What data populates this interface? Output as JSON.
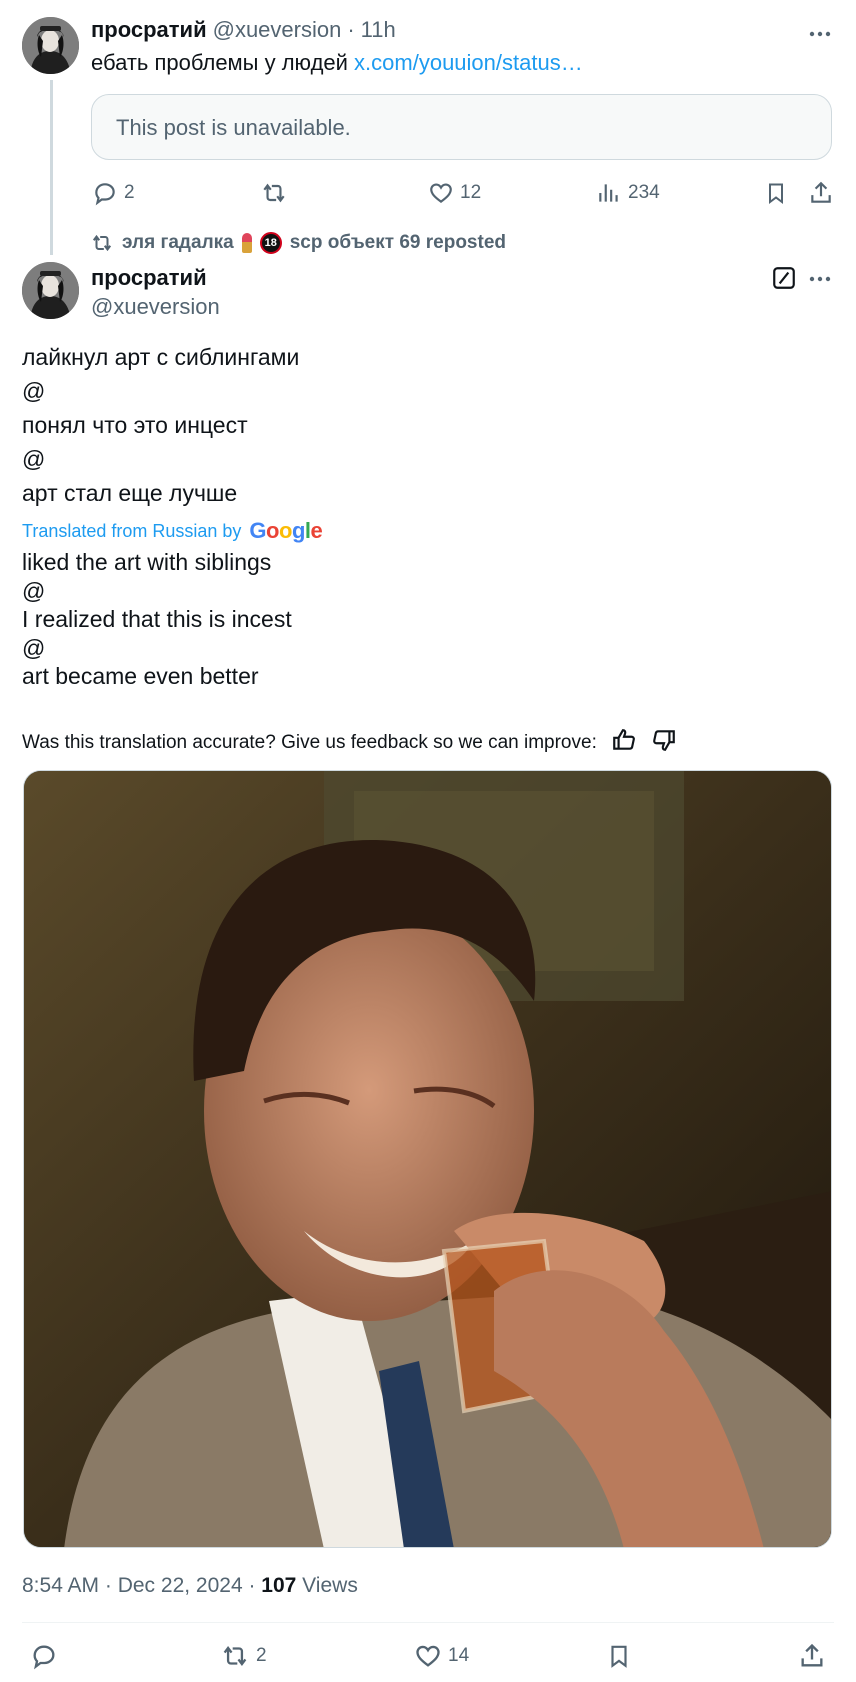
{
  "post1": {
    "author_name": "просратий",
    "author_handle": "@xueversion",
    "separator": "·",
    "time": "11h",
    "text_prefix": "ебать проблемы у людей ",
    "link_text": "x.com/youuion/status…",
    "quote_unavailable": "This post is unavailable.",
    "actions": {
      "replies": "2",
      "reposts": "",
      "likes": "12",
      "views": "234"
    }
  },
  "repost_banner": {
    "user1": "эля гадалка",
    "badge": "18",
    "user2_and_label": "scp объект 69 reposted"
  },
  "post2": {
    "author_name": "просратий",
    "author_handle": "@xueversion",
    "original_lines": [
      "лайкнул арт с сиблингами",
      "@",
      "понял что это инцест",
      "@",
      "арт стал еще лучше"
    ],
    "translated_from": "Translated from Russian by",
    "google_letters": [
      "G",
      "o",
      "o",
      "g",
      "l",
      "e"
    ],
    "translated_lines": [
      "liked the art with siblings",
      "@",
      "I realized that this is incest",
      "@",
      "art became even better"
    ],
    "feedback_prompt": "Was this translation accurate? Give us feedback so we can improve:",
    "meta": {
      "time_date": "8:54 AM · Dec 22, 2024 · ",
      "views_count": "107",
      "views_label": " Views"
    },
    "actions": {
      "replies": "",
      "reposts": "2",
      "likes": "14"
    }
  },
  "colors": {
    "accent": "#1d9bf0",
    "text": "#0f1419",
    "muted": "#536471",
    "border": "#cfd9de"
  }
}
